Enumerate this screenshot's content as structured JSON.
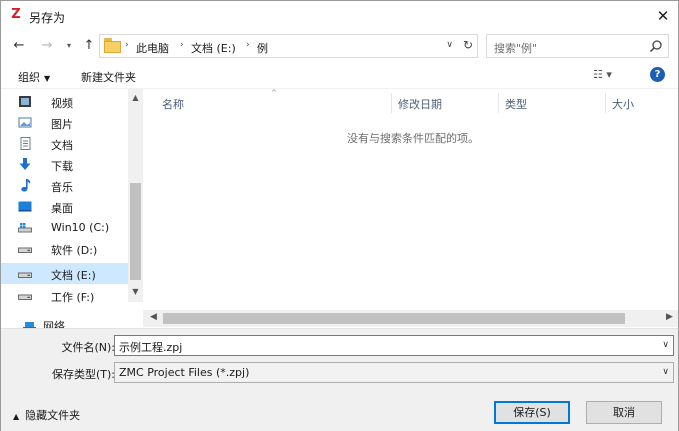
{
  "window": {
    "title": "另存为",
    "app_icon_glyph": "Z",
    "close_glyph": "✕"
  },
  "nav": {
    "back_glyph": "←",
    "forward_glyph": "→",
    "recent_glyph": "▾",
    "up_glyph": "↑",
    "breadcrumbs": [
      "此电脑",
      "文档 (E:)",
      "例"
    ],
    "crumb_sep": "›",
    "address_dropdown": "∨",
    "refresh_glyph": "↻",
    "search_placeholder": "搜索\"例\""
  },
  "toolbar": {
    "organize": "组织",
    "organize_caret": "▼",
    "new_folder": "新建文件夹",
    "view_glyph": "☷ ▾",
    "help": "?"
  },
  "sidebar": {
    "items": [
      {
        "label": "视频",
        "icon": "video-icon"
      },
      {
        "label": "图片",
        "icon": "pictures-icon"
      },
      {
        "label": "文档",
        "icon": "documents-icon"
      },
      {
        "label": "下载",
        "icon": "downloads-icon"
      },
      {
        "label": "音乐",
        "icon": "music-icon"
      },
      {
        "label": "桌面",
        "icon": "desktop-icon"
      },
      {
        "label": "Win10 (C:)",
        "icon": "system-drive-icon"
      },
      {
        "label": "软件 (D:)",
        "icon": "drive-icon"
      },
      {
        "label": "文档 (E:)",
        "icon": "drive-icon",
        "selected": true
      },
      {
        "label": "工作 (F:)",
        "icon": "drive-icon"
      },
      {
        "label": "网络",
        "icon": "network-icon"
      }
    ]
  },
  "filelist": {
    "columns": [
      "名称",
      "修改日期",
      "类型",
      "大小"
    ],
    "sort_glyph": "^",
    "empty_message": "没有与搜索条件匹配的项。"
  },
  "scroll": {
    "up": "▲",
    "down": "▼",
    "left": "◀",
    "right": "▶"
  },
  "form": {
    "filename_label": "文件名(N):",
    "filename_value": "示例工程.zpj",
    "filetype_label": "保存类型(T):",
    "filetype_value": "ZMC Project Files (*.zpj)",
    "dropdown_glyph": "∨",
    "hide_folders": "隐藏文件夹",
    "hide_caret": "▲",
    "save": "保存(S)",
    "cancel": "取消"
  }
}
